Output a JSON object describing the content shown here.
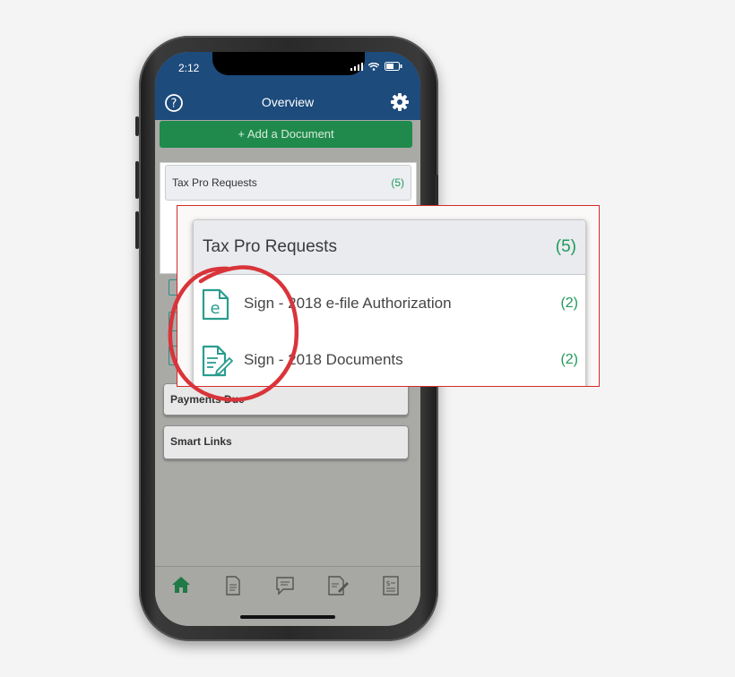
{
  "status_bar": {
    "time": "2:12"
  },
  "app_bar": {
    "title": "Overview",
    "left_icon": "help-icon",
    "right_icon": "gear-icon"
  },
  "add_document": {
    "label": "+ Add a Document"
  },
  "sections": {
    "tax_pro_requests": {
      "title": "Tax Pro Requests",
      "count": "(5)"
    },
    "payments_due": {
      "title": "Payments Due"
    },
    "smart_links": {
      "title": "Smart Links"
    }
  },
  "zoom": {
    "title": "Tax Pro Requests",
    "count": "(5)",
    "items": [
      {
        "label": "Sign - 2018 e-file Authorization",
        "count": "(2)",
        "icon": "efile-document-icon"
      },
      {
        "label": "Sign - 2018 Documents",
        "count": "(2)",
        "icon": "sign-document-icon"
      }
    ]
  },
  "bottom_nav": [
    "home-icon",
    "document-icon",
    "chat-icon",
    "tax-form-icon",
    "invoice-icon"
  ],
  "colors": {
    "app_bar": "#1c4b7c",
    "accent_green": "#1f8a4c",
    "count_green": "#1f9a5a",
    "highlight_red": "#d52a2a"
  }
}
